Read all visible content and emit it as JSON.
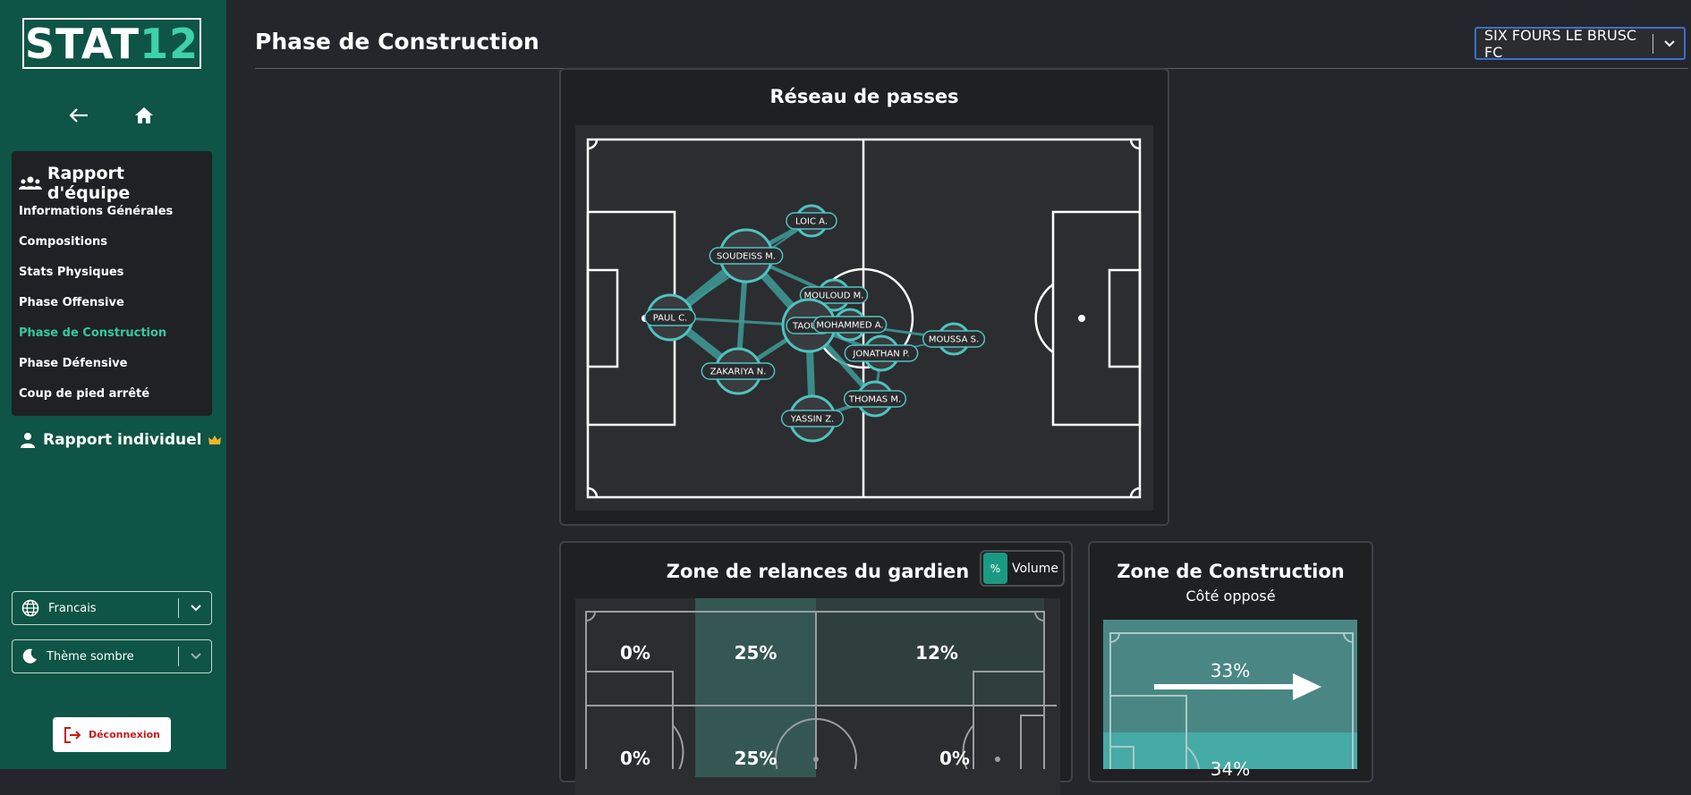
{
  "sidebar": {
    "logo_text_white": "STAT",
    "logo_text_green": "12",
    "nav_title": "Rapport d'équipe",
    "nav_items": [
      {
        "label": "Informations Générales"
      },
      {
        "label": "Compositions"
      },
      {
        "label": "Stats Physiques"
      },
      {
        "label": "Phase Offensive"
      },
      {
        "label": "Phase de Construction",
        "active": true
      },
      {
        "label": "Phase Défensive"
      },
      {
        "label": "Coup de pied arrêté"
      }
    ],
    "individual_label": "Rapport individuel",
    "language": "Francais",
    "theme": "Thème sombre",
    "logout_label": "Déconnexion"
  },
  "header": {
    "title": "Phase de Construction",
    "team": "SIX FOURS LE BRUSC FC"
  },
  "pass_network": {
    "title": "Réseau de passes",
    "players": [
      {
        "name": "LOIC A."
      },
      {
        "name": "SOUDEISS M."
      },
      {
        "name": "PAUL C."
      },
      {
        "name": "MOULOUD M."
      },
      {
        "name": "TAOUFI"
      },
      {
        "name": "MOHAMMED A."
      },
      {
        "name": "MOUSSA S."
      },
      {
        "name": "JONATHAN P."
      },
      {
        "name": "ZAKARIYA N."
      },
      {
        "name": "THOMAS M."
      },
      {
        "name": "YASSIN Z."
      }
    ]
  },
  "goalkeeper_zone": {
    "title": "Zone de relances du gardien",
    "toggle_pct": "%",
    "toggle_volume": "Volume",
    "row1": [
      "0%",
      "25%",
      "12%"
    ],
    "row2": [
      "0%",
      "25%",
      "0%"
    ]
  },
  "construction_zone": {
    "title": "Zone de Construction",
    "subtitle": "Côté opposé",
    "top_value": "33%",
    "bottom_value": "34%"
  },
  "colors": {
    "sidebar": "#0e5447",
    "accent": "#33c9a5",
    "background": "#24262b",
    "node": "#4fc3c0"
  }
}
